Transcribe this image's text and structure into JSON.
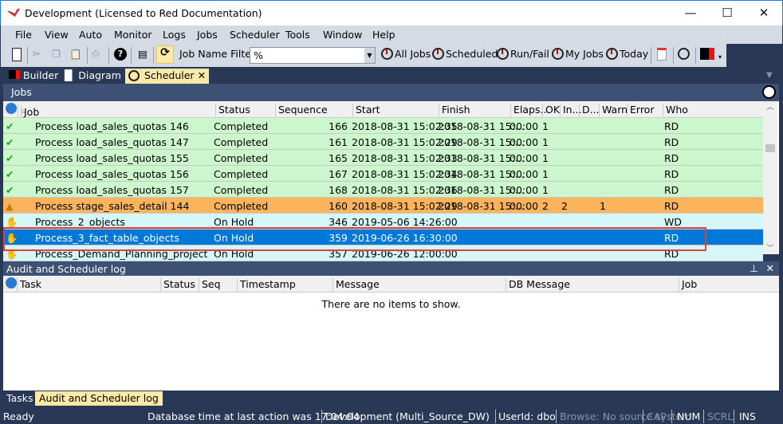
{
  "window": {
    "title": "Development  (Licensed to Red Documentation)",
    "minimize": "—",
    "maximize": "☐",
    "close": "✕"
  },
  "menu": [
    "File",
    "View",
    "Auto",
    "Monitor",
    "Logs",
    "Jobs",
    "Scheduler",
    "Tools",
    "Window",
    "Help"
  ],
  "toolbar": {
    "filter_label": "Job Name Filter:",
    "filter_value": "%",
    "buttons": [
      "All Jobs",
      "Scheduled",
      "Run/Fail",
      "My Jobs",
      "Today"
    ]
  },
  "tabs": [
    "Builder",
    "Diagram",
    "Scheduler"
  ],
  "jobs": {
    "title": "Jobs",
    "columns": [
      "Job",
      "Status",
      "Sequence",
      "Start",
      "Finish",
      "Elaps...",
      "OK",
      "In...",
      "D...",
      "Warn",
      "Error",
      "Who"
    ],
    "rows": [
      {
        "job": "Process load_sales_quotas 146",
        "status": "Completed",
        "seq": "166",
        "start": "2018-08-31 15:02:35",
        "finish": "2018-08-31 15:...",
        "elapsed": "00:00",
        "ok": "1",
        "info": "",
        "detail": "",
        "warn": "",
        "error": "",
        "who": "RD",
        "type": "ok"
      },
      {
        "job": "Process load_sales_quotas 147",
        "status": "Completed",
        "seq": "161",
        "start": "2018-08-31 15:02:29",
        "finish": "2018-08-31 15:...",
        "elapsed": "00:00",
        "ok": "1",
        "info": "",
        "detail": "",
        "warn": "",
        "error": "",
        "who": "RD",
        "type": "ok"
      },
      {
        "job": "Process load_sales_quotas 155",
        "status": "Completed",
        "seq": "165",
        "start": "2018-08-31 15:02:33",
        "finish": "2018-08-31 15:...",
        "elapsed": "00:00",
        "ok": "1",
        "info": "",
        "detail": "",
        "warn": "",
        "error": "",
        "who": "RD",
        "type": "ok"
      },
      {
        "job": "Process load_sales_quotas 156",
        "status": "Completed",
        "seq": "167",
        "start": "2018-08-31 15:02:34",
        "finish": "2018-08-31 15:...",
        "elapsed": "00:00",
        "ok": "1",
        "info": "",
        "detail": "",
        "warn": "",
        "error": "",
        "who": "RD",
        "type": "ok"
      },
      {
        "job": "Process load_sales_quotas 157",
        "status": "Completed",
        "seq": "168",
        "start": "2018-08-31 15:02:36",
        "finish": "2018-08-31 15:...",
        "elapsed": "00:00",
        "ok": "1",
        "info": "",
        "detail": "",
        "warn": "",
        "error": "",
        "who": "RD",
        "type": "ok"
      },
      {
        "job": "Process stage_sales_detail 144",
        "status": "Completed",
        "seq": "160",
        "start": "2018-08-31 15:02:29",
        "finish": "2018-08-31 15:...",
        "elapsed": "00:00",
        "ok": "2",
        "info": "2",
        "detail": "",
        "warn": "1",
        "error": "",
        "who": "RD",
        "type": "warn"
      },
      {
        "job": "Process_2_objects",
        "status": "On Hold",
        "seq": "346",
        "start": "2019-05-06 14:26:00",
        "finish": "",
        "elapsed": "",
        "ok": "",
        "info": "",
        "detail": "",
        "warn": "",
        "error": "",
        "who": "WD",
        "type": "hold"
      },
      {
        "job": "Process_3_fact_table_objects",
        "status": "On Hold",
        "seq": "359",
        "start": "2019-06-26 16:30:00",
        "finish": "",
        "elapsed": "",
        "ok": "",
        "info": "",
        "detail": "",
        "warn": "",
        "error": "",
        "who": "RD",
        "type": "selected"
      },
      {
        "job": "Process_Demand_Planning_project",
        "status": "On Hold",
        "seq": "357",
        "start": "2019-06-26 12:00:00",
        "finish": "",
        "elapsed": "",
        "ok": "",
        "info": "",
        "detail": "",
        "warn": "",
        "error": "",
        "who": "RD",
        "type": "hold"
      }
    ]
  },
  "log": {
    "title": "Audit and Scheduler log",
    "columns": [
      "Task",
      "Status",
      "Seq",
      "Timestamp",
      "Message",
      "DB Message",
      "Job"
    ],
    "empty": "There are no items to show."
  },
  "bottom_tabs": [
    "Tasks",
    "Audit and Scheduler log"
  ],
  "statusbar": {
    "ready": "Ready",
    "dbtime": "Database time at last action was 17:04:04",
    "env": "Development (Multi_Source_DW)",
    "user": "UserId: dbo",
    "browse": "Browse: No source system",
    "cap": "CAP",
    "num": "NUM",
    "scrl": "SCRL",
    "ins": "INS"
  },
  "colors": {
    "ok": "#ccf7cc",
    "warn": "#fbb45c",
    "hold": "#d6f7f7",
    "selected": "#0078d7",
    "highlight_box": "#e04040"
  }
}
